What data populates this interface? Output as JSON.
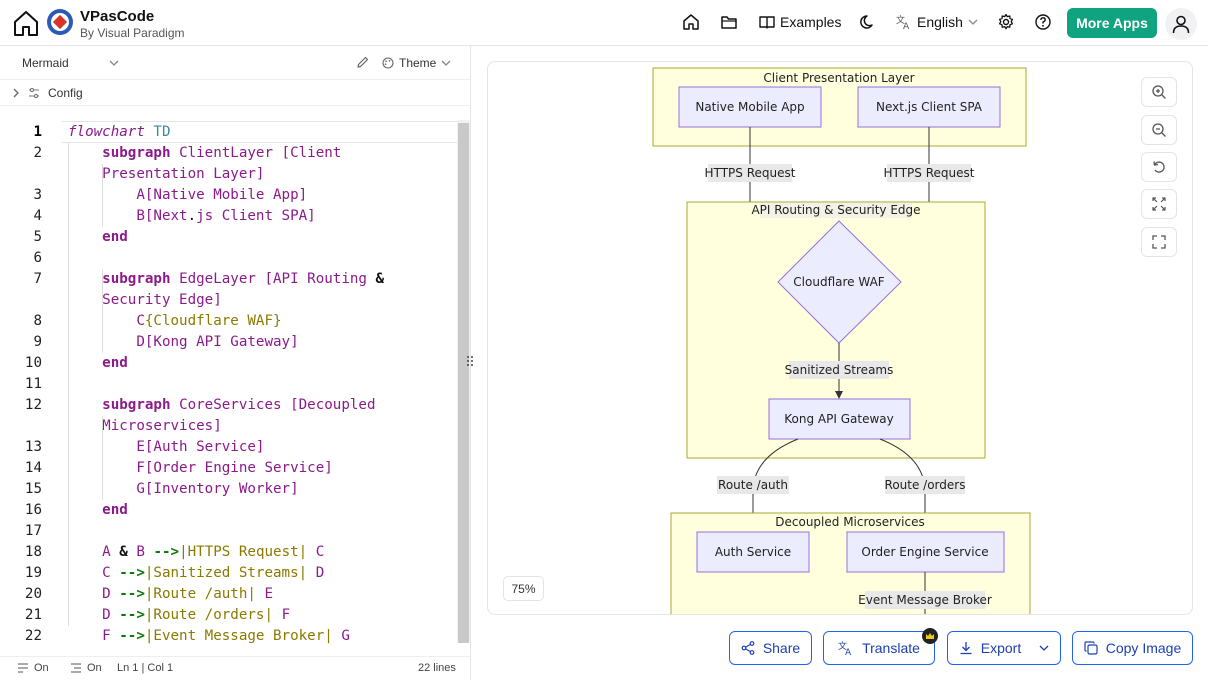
{
  "header": {
    "brand_name": "VPasCode",
    "brand_sub": "By Visual Paradigm",
    "examples_label": "Examples",
    "language_label": "English",
    "more_apps_label": "More Apps"
  },
  "toolbar": {
    "mode": "Mermaid",
    "theme_label": "Theme",
    "config_label": "Config"
  },
  "editor": {
    "lines": [
      {
        "n": "1",
        "html": "<span class=\"kw2\">flowchart</span> <span class=\"td\">TD</span>"
      },
      {
        "n": "2",
        "html": "    <span class=\"kw\">subgraph</span> <span class=\"str\">ClientLayer [Client</span>"
      },
      {
        "n": "",
        "html": "    <span class=\"str\">Presentation Layer]</span>"
      },
      {
        "n": "3",
        "html": "        <span class=\"str\">A[Native Mobile App]</span>"
      },
      {
        "n": "4",
        "html": "        <span class=\"str\">B[Next<span style=\"color:#111\">.</span>js Client SPA]</span>"
      },
      {
        "n": "5",
        "html": "    <span class=\"kw\">end</span>"
      },
      {
        "n": "6",
        "html": ""
      },
      {
        "n": "7",
        "html": "    <span class=\"kw\">subgraph</span> <span class=\"str\">EdgeLayer [API Routing</span> <span style=\"color:#111;font-weight:600\">&amp;</span>"
      },
      {
        "n": "",
        "html": "    <span class=\"str\">Security Edge]</span>"
      },
      {
        "n": "8",
        "html": "        <span class=\"str\">C</span><span class=\"str2\">{Cloudflare WAF}</span>"
      },
      {
        "n": "9",
        "html": "        <span class=\"str\">D[Kong API Gateway]</span>"
      },
      {
        "n": "10",
        "html": "    <span class=\"kw\">end</span>"
      },
      {
        "n": "11",
        "html": ""
      },
      {
        "n": "12",
        "html": "    <span class=\"kw\">subgraph</span> <span class=\"str\">CoreServices [Decoupled</span>"
      },
      {
        "n": "",
        "html": "    <span class=\"str\">Microservices]</span>"
      },
      {
        "n": "13",
        "html": "        <span class=\"str\">E[Auth Service]</span>"
      },
      {
        "n": "14",
        "html": "        <span class=\"str\">F[Order Engine Service]</span>"
      },
      {
        "n": "15",
        "html": "        <span class=\"str\">G[Inventory Worker]</span>"
      },
      {
        "n": "16",
        "html": "    <span class=\"kw\">end</span>"
      },
      {
        "n": "17",
        "html": ""
      },
      {
        "n": "18",
        "html": "    <span class=\"str\">A</span> <span style=\"color:#111;font-weight:600\">&amp;</span> <span class=\"str\">B</span> <span class=\"arrow\">--&gt;</span><span class=\"str2\">|HTTPS Request|</span> <span class=\"str\">C</span>"
      },
      {
        "n": "19",
        "html": "    <span class=\"str\">C</span> <span class=\"arrow\">--&gt;</span><span class=\"str2\">|Sanitized Streams|</span> <span class=\"str\">D</span>"
      },
      {
        "n": "20",
        "html": "    <span class=\"str\">D</span> <span class=\"arrow\">--&gt;</span><span class=\"str2\">|Route /auth|</span> <span class=\"str\">E</span>"
      },
      {
        "n": "21",
        "html": "    <span class=\"str\">D</span> <span class=\"arrow\">--&gt;</span><span class=\"str2\">|Route /orders|</span> <span class=\"str\">F</span>"
      },
      {
        "n": "22",
        "html": "    <span class=\"str\">F</span> <span class=\"arrow\">--&gt;</span><span class=\"str2\">|Event Message Broker|</span> <span class=\"str\">G</span>"
      }
    ]
  },
  "status": {
    "wrap": "On",
    "indent": "On",
    "position": "Ln 1 | Col 1",
    "lines_count": "22 lines"
  },
  "diagram": {
    "client_layer": "Client Presentation Layer",
    "node_a": "Native Mobile App",
    "node_b": "Next.js Client SPA",
    "edge_https_1": "HTTPS Request",
    "edge_https_2": "HTTPS Request",
    "edge_layer": "API Routing & Security Edge",
    "node_c": "Cloudflare WAF",
    "edge_sanitized": "Sanitized Streams",
    "node_d": "Kong API Gateway",
    "edge_auth": "Route /auth",
    "edge_orders": "Route /orders",
    "core_layer": "Decoupled Microservices",
    "node_e": "Auth Service",
    "node_f": "Order Engine Service",
    "edge_broker": "Event Message Broker"
  },
  "canvas": {
    "zoom": "75%"
  },
  "actions": {
    "share": "Share",
    "translate": "Translate",
    "export": "Export",
    "copy_image": "Copy Image"
  }
}
